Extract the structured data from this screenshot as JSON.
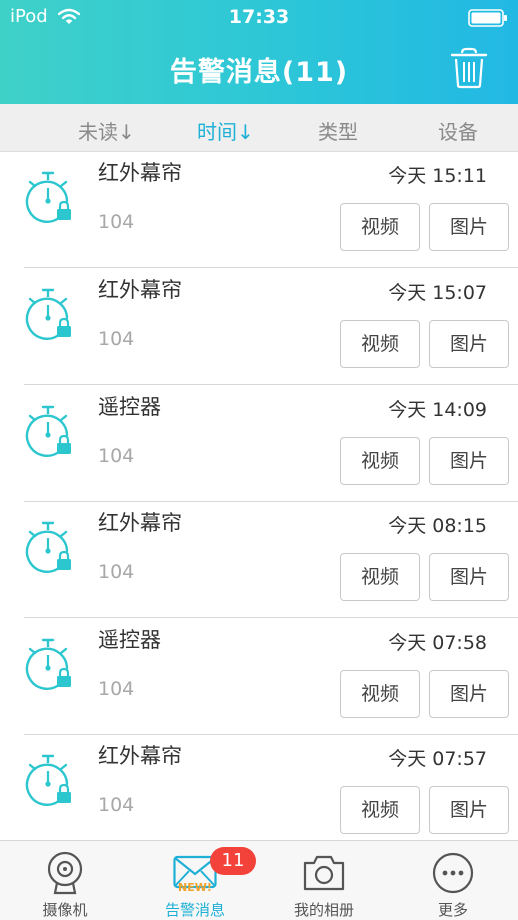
{
  "status_bar": {
    "carrier": "iPod",
    "time": "17:33"
  },
  "header": {
    "title": "告警消息(11)"
  },
  "sort_tabs": [
    {
      "label": "未读↓",
      "active": false
    },
    {
      "label": "时间↓",
      "active": true
    },
    {
      "label": "类型",
      "active": false
    },
    {
      "label": "设备",
      "active": false
    }
  ],
  "alerts": [
    {
      "type": "红外幕帘",
      "time": "今天 15:11",
      "id": "104",
      "video": "视频",
      "image": "图片"
    },
    {
      "type": "红外幕帘",
      "time": "今天 15:07",
      "id": "104",
      "video": "视频",
      "image": "图片"
    },
    {
      "type": "遥控器",
      "time": "今天 14:09",
      "id": "104",
      "video": "视频",
      "image": "图片"
    },
    {
      "type": "红外幕帘",
      "time": "今天 08:15",
      "id": "104",
      "video": "视频",
      "image": "图片"
    },
    {
      "type": "遥控器",
      "time": "今天 07:58",
      "id": "104",
      "video": "视频",
      "image": "图片"
    },
    {
      "type": "红外幕帘",
      "time": "今天 07:57",
      "id": "104",
      "video": "视频",
      "image": "图片"
    }
  ],
  "tabbar": {
    "items": [
      {
        "label": "摄像机",
        "icon": "camera-device-icon"
      },
      {
        "label": "告警消息",
        "icon": "envelope-icon",
        "badge": "11",
        "tag": "NEW!"
      },
      {
        "label": "我的相册",
        "icon": "photo-camera-icon"
      },
      {
        "label": "更多",
        "icon": "more-icon"
      }
    ]
  },
  "colors": {
    "accent": "#1fb0d6",
    "header_start": "#3fd1c8",
    "header_end": "#22b8e4",
    "badge": "#f2423a",
    "icon": "#2cc6cf"
  }
}
